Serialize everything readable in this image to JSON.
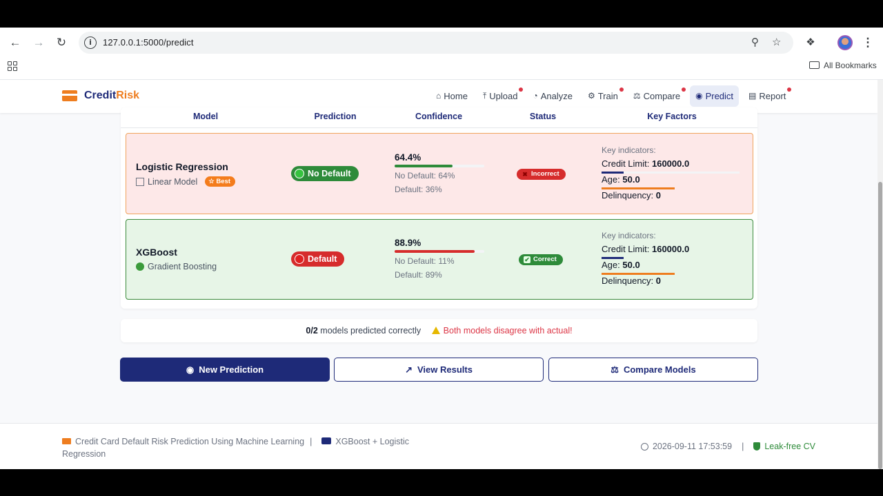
{
  "browser": {
    "url": "127.0.0.1:5000/predict",
    "bookmarks_label": "All Bookmarks"
  },
  "app": {
    "logo_main": "Credit",
    "logo_accent": "Risk",
    "nav": [
      {
        "label": "Home",
        "icon": "home-icon",
        "dot": false,
        "active": false
      },
      {
        "label": "Upload",
        "icon": "upload-icon",
        "dot": true,
        "active": false
      },
      {
        "label": "Analyze",
        "icon": "pie-chart-icon",
        "dot": false,
        "active": false
      },
      {
        "label": "Train",
        "icon": "robot-icon",
        "dot": true,
        "active": false
      },
      {
        "label": "Compare",
        "icon": "balance-scale-icon",
        "dot": true,
        "active": false
      },
      {
        "label": "Predict",
        "icon": "brain-icon",
        "dot": false,
        "active": true
      },
      {
        "label": "Report",
        "icon": "file-icon",
        "dot": true,
        "active": false
      }
    ]
  },
  "table": {
    "headers": [
      "Model",
      "Prediction",
      "Confidence",
      "Status",
      "Key Factors"
    ],
    "rows": [
      {
        "model": "Logistic Regression",
        "type": "Linear Model",
        "badge": "Best",
        "prediction": "No Default",
        "confidence": "64.4%",
        "confidence_fraction": 0.644,
        "no_default": "No Default: 64%",
        "default": "Default: 36%",
        "status": "Incorrect",
        "kf_title": "Key indicators:",
        "kf": [
          {
            "label": "Credit Limit:",
            "value": "160000.0"
          },
          {
            "label": "Age:",
            "value": "50.0"
          },
          {
            "label": "Delinquency:",
            "value": "0"
          }
        ]
      },
      {
        "model": "XGBoost",
        "type": "Gradient Boosting",
        "prediction": "Default",
        "confidence": "88.9%",
        "confidence_fraction": 0.889,
        "no_default": "No Default: 11%",
        "default": "Default: 89%",
        "status": "Correct",
        "kf_title": "Key indicators:",
        "kf": [
          {
            "label": "Credit Limit:",
            "value": "160000.0"
          },
          {
            "label": "Age:",
            "value": "50.0"
          },
          {
            "label": "Delinquency:",
            "value": "0"
          }
        ]
      }
    ]
  },
  "summary": {
    "score": "0/2",
    "text": "models predicted correctly",
    "warning": "Both models disagree with actual!"
  },
  "buttons": {
    "new_prediction": "New Prediction",
    "view_results": "View Results",
    "compare_models": "Compare Models"
  },
  "footer": {
    "title": "Credit Card Default Risk Prediction Using Machine Learning",
    "models": "XGBoost + Logistic",
    "models_line2": "Regression",
    "timestamp": "2026-09-11 17:53:59",
    "badge": "Leak-free CV"
  },
  "colors": {
    "brand": "#1e2a78",
    "accent": "#ee7d1f",
    "success": "#2e8b3a",
    "danger": "#d62c2c"
  }
}
